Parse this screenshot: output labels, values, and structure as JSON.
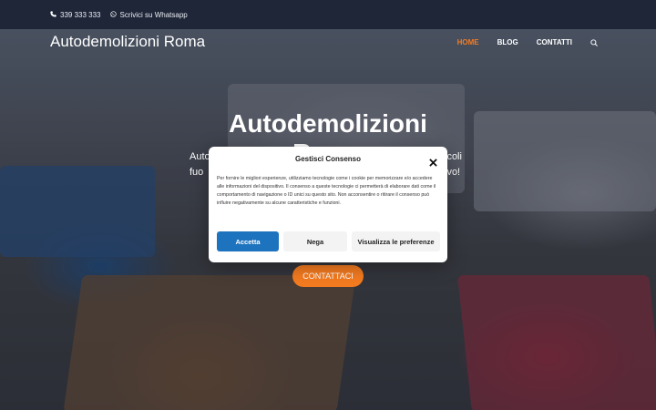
{
  "topbar": {
    "phone": "339 333 333",
    "whatsapp": "Scrivici su Whatsapp"
  },
  "header": {
    "logo": "Autodemolizioni Roma",
    "nav": [
      {
        "label": "HOME",
        "active": true
      },
      {
        "label": "BLOG",
        "active": false
      },
      {
        "label": "CONTATTI",
        "active": false
      }
    ],
    "search_icon": "search-icon"
  },
  "hero": {
    "title": "Autodemolizioni Roma",
    "text_left": [
      "Auto",
      "fuo"
    ],
    "text_right": [
      "icoli",
      "ivo!"
    ],
    "cta_label": "CONTATTACI"
  },
  "consent": {
    "title": "Gestisci Consenso",
    "body": "Per fornire le migliori esperienze, utilizziamo tecnologie come i cookie per memorizzare e/o accedere alle informazioni del dispositivo. Il consenso a queste tecnologie ci permetterà di elaborare dati come il comportamento di navigazione o ID unici su questo sito. Non acconsentire o ritirare il consenso può influire negativamente su alcune caratteristiche e funzioni.",
    "accept": "Accetta",
    "deny": "Nega",
    "preferences": "Visualizza le preferenze"
  },
  "colors": {
    "accent": "#f47b20",
    "primary_button": "#1e73be",
    "topbar": "#1f2638"
  }
}
